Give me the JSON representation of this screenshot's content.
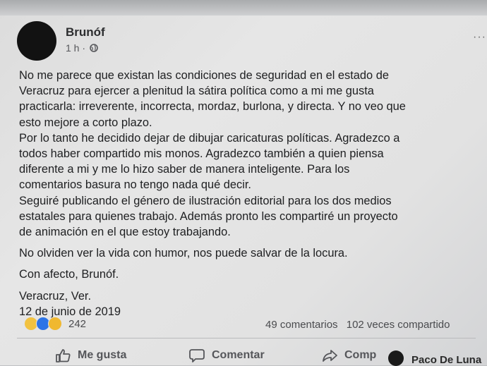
{
  "post": {
    "author": "Brunóf",
    "time": "1 h ·",
    "more_icon": "ellipsis-icon",
    "lines": [
      "No me parece que existan las condiciones de seguridad en el estado de",
      "Veracruz para ejercer a plenitud la sátira política como a mi me gusta",
      "practicarla: irreverente, incorrecta, mordaz, burlona, y directa. Y no veo que",
      "esto mejore a corto plazo.",
      "Por lo tanto he decidido dejar de dibujar caricaturas políticas. Agradezco a",
      "todos haber compartido mis monos. Agradezco también a quien piensa",
      "diferente a mi y me lo hizo saber de manera inteligente. Para los",
      "comentarios basura no tengo nada qué decir.",
      "Seguiré publicando el género de ilustración editorial para los dos medios",
      "estatales para quienes trabajo. Además pronto les compartiré un proyecto",
      "de animación en el que estoy trabajando."
    ],
    "closing": "No olviden ver la vida con humor, nos puede salvar de la locura.",
    "signoff": "Con afecto, Brunóf.",
    "place": "Veracruz, Ver.",
    "date": "12 de junio de 2019"
  },
  "reactions": {
    "icons": [
      "sad-reaction-icon",
      "like-reaction-icon",
      "wow-reaction-icon"
    ],
    "count": "242",
    "comments": "49 comentarios",
    "shares": "102 veces compartido"
  },
  "actions": {
    "like": "Me gusta",
    "comment": "Comentar",
    "share": "Comp"
  },
  "contact": {
    "name": "Paco De Luna"
  },
  "colors": {
    "like_blue": "#2d74e6",
    "reaction_yellow": "#f2c240",
    "text": "#1e1f21"
  }
}
